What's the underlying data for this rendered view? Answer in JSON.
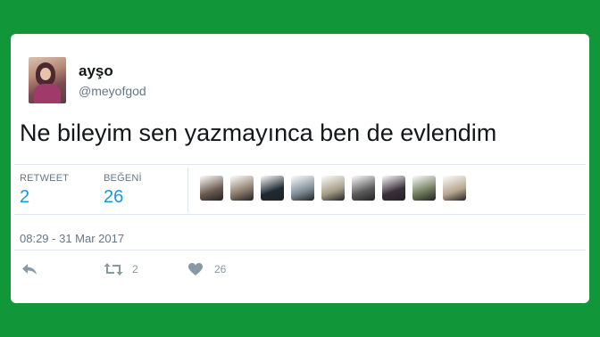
{
  "user": {
    "name": "ayşo",
    "handle": "@meyofgod"
  },
  "tweet": {
    "text": "Ne bileyim sen yazmayınca ben de evlendim",
    "timestamp": "08:29 - 31 Mar 2017"
  },
  "stats": {
    "retweet_label": "RETWEET",
    "retweet_count": "2",
    "like_label": "BEĞENİ",
    "like_count": "26"
  },
  "actions": {
    "reply_icon": "reply-icon",
    "retweet_icon": "retweet-icon",
    "retweet_count": "2",
    "like_icon": "heart-icon",
    "like_count": "26"
  },
  "likers": [
    {
      "color": "#6b5a50"
    },
    {
      "color": "#8a7a6a"
    },
    {
      "color": "#1e2a34"
    },
    {
      "color": "#7e8c96"
    },
    {
      "color": "#a39b86"
    },
    {
      "color": "#5a5a5a"
    },
    {
      "color": "#3a2f3a"
    },
    {
      "color": "#6e7b5a"
    },
    {
      "color": "#b7a58f"
    }
  ],
  "colors": {
    "background": "#11973a",
    "accent": "#1b95e0",
    "muted": "#657786"
  }
}
